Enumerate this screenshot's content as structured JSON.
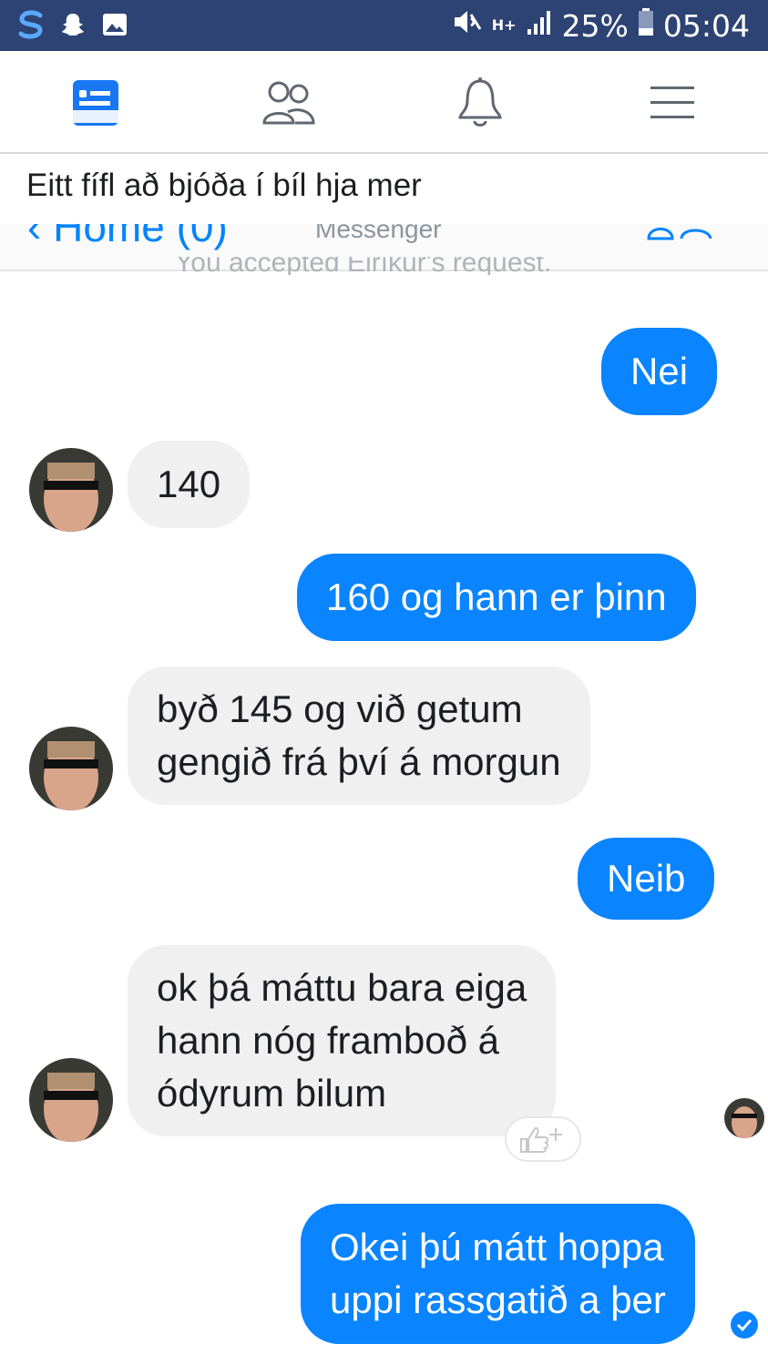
{
  "status_bar": {
    "battery": "25%",
    "time": "05:04",
    "network": "H+",
    "icons": [
      "s-app-icon",
      "snapchat-icon",
      "gallery-icon",
      "mute-icon",
      "signal-icon",
      "battery-icon"
    ]
  },
  "fb_nav": {
    "icons": [
      "news-feed-icon",
      "friends-icon",
      "notifications-icon",
      "menu-icon"
    ],
    "accent": "#1877f2"
  },
  "post": {
    "caption": "Eitt fífl að bjóða í bíl hja mer"
  },
  "messenger": {
    "back_label": "Home (0)",
    "header_title": "Messenger",
    "accepted_text": "You accepted Eiríkur's request.",
    "messages": [
      {
        "from": "me",
        "text": "Nei"
      },
      {
        "from": "other",
        "text": "140"
      },
      {
        "from": "me",
        "text": "160 og hann er þinn"
      },
      {
        "from": "other",
        "text": "byð 145 og við getum\ngengið frá því á morgun"
      },
      {
        "from": "me",
        "text": "Neib"
      },
      {
        "from": "other",
        "text": "ok þá máttu bara eiga\nhann  nóg framboð á\nódyrum bilum"
      },
      {
        "from": "me",
        "text": "Okei þú mátt hoppa\nuppi rassgatið a þer"
      }
    ],
    "reaction_icon": "thumbs-up-add-icon",
    "colors": {
      "outgoing": "#0a84ff",
      "incoming": "#f1f0f0"
    }
  }
}
